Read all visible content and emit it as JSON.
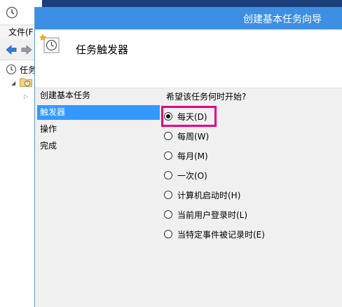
{
  "background_window": {
    "menu_file": "文件(F",
    "tree_root_label": "任务"
  },
  "dialog": {
    "title": "创建基本任务向导",
    "header_title": "任务触发器",
    "steps": [
      {
        "label": "创建基本任务"
      },
      {
        "label": "触发器"
      },
      {
        "label": "操作"
      },
      {
        "label": "完成"
      }
    ],
    "question": "希望该任务何时开始?",
    "options": [
      {
        "label": "每天(D)",
        "checked": true
      },
      {
        "label": "每周(W)",
        "checked": false
      },
      {
        "label": "每月(M)",
        "checked": false
      },
      {
        "label": "一次(O)",
        "checked": false
      },
      {
        "label": "计算机启动时(H)",
        "checked": false
      },
      {
        "label": "当前用户登录时(L)",
        "checked": false
      },
      {
        "label": "当特定事件被记录时(E)",
        "checked": false
      }
    ]
  },
  "colors": {
    "title_bar": "#3d8fe3",
    "selected_step": "#3399ff",
    "highlight_box": "#e5007e",
    "desktop": "#1b3f7a"
  }
}
